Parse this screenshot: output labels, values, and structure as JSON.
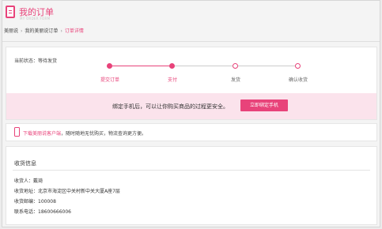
{
  "header": {
    "title": "我的订单",
    "subtitle": "MY ORDER FORM"
  },
  "breadcrumb": [
    "美丽说",
    "我的美丽说订单",
    "订单详情"
  ],
  "status": {
    "text": "当前状态：等待发货",
    "steps": [
      "提交订单",
      "支付",
      "发货",
      "确认收货"
    ],
    "completed_steps": 2
  },
  "banner": {
    "text": "绑定手机后，可以让你购买商品的过程更安全。",
    "button_label": "立即绑定手机"
  },
  "app_promo": {
    "link_text": "下载美丽说客户端",
    "rest_text": "，随时随地无忧购买，物流查询更方便。"
  },
  "shipping": {
    "heading": "收货信息",
    "rows": [
      "收货人：戴琦",
      "收货地址：北京市海淀区中关村新中关大厦A座7层",
      "收货邮编：100008",
      "联系电话：18600666006"
    ]
  },
  "colors": {
    "accent": "#e8437a",
    "banner_bg": "#fbe3ec"
  }
}
